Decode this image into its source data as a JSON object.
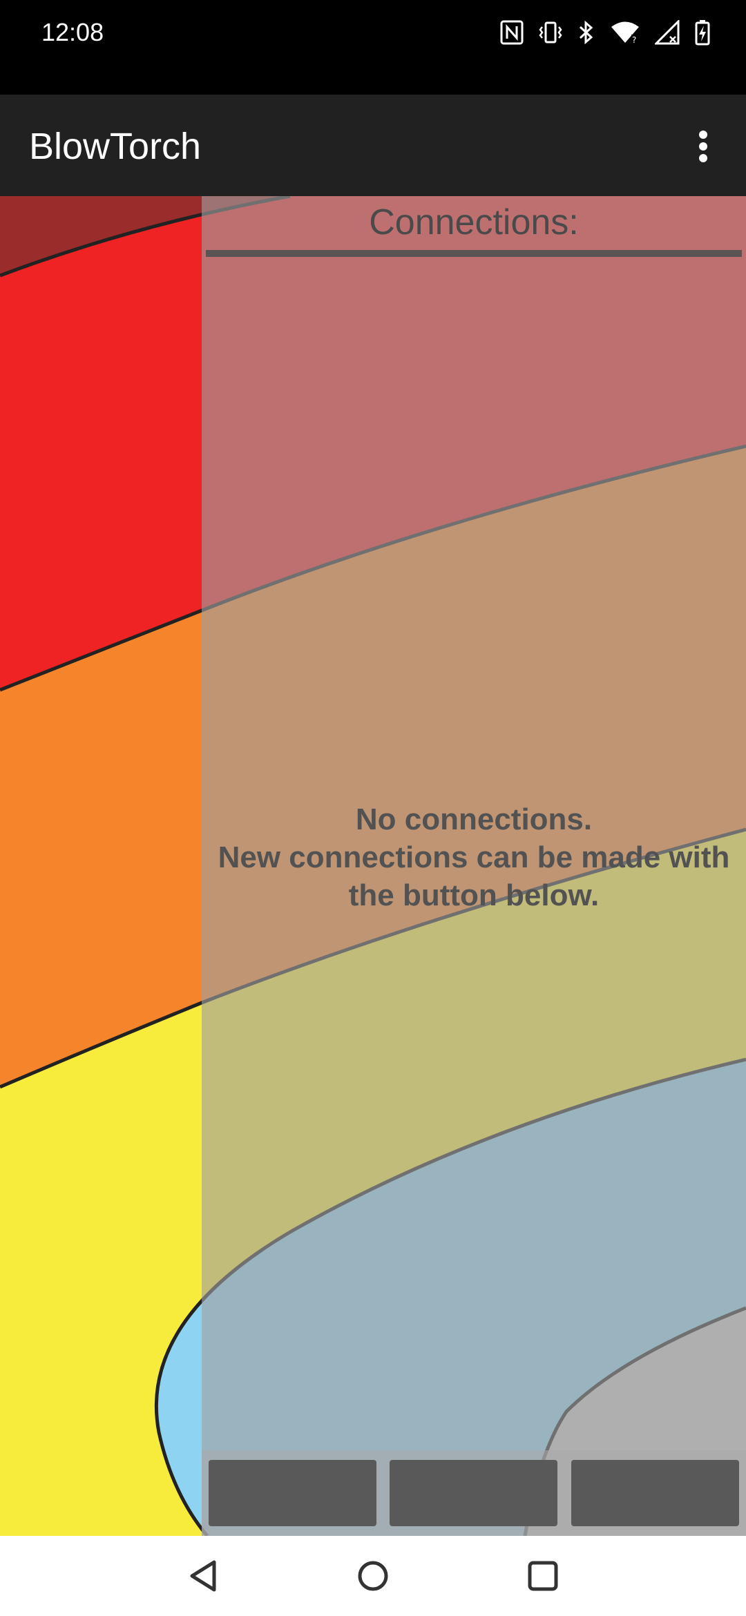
{
  "status_bar": {
    "time": "12:08",
    "icons": [
      "nfc-icon",
      "vibrate-icon",
      "bluetooth-icon",
      "wifi-icon",
      "cellular-icon",
      "battery-charging-icon"
    ]
  },
  "app_bar": {
    "title": "BlowTorch",
    "overflow_icon": "more-vert-icon"
  },
  "connections_panel": {
    "title": "Connections:",
    "empty_message_line1": "No connections.",
    "empty_message_line2": "New connections can be made with",
    "empty_message_line3": "the button below.",
    "buttons": [
      "",
      "",
      ""
    ]
  },
  "nav_bar": {
    "icons": [
      "back-icon",
      "home-icon",
      "recents-icon"
    ]
  },
  "colors": {
    "app_bar": "#212121",
    "button": "#595959",
    "art_red": "#ef2323",
    "art_orange": "#f5842a",
    "art_yellow": "#f7eb3b",
    "art_blue": "#8fd3f2"
  }
}
